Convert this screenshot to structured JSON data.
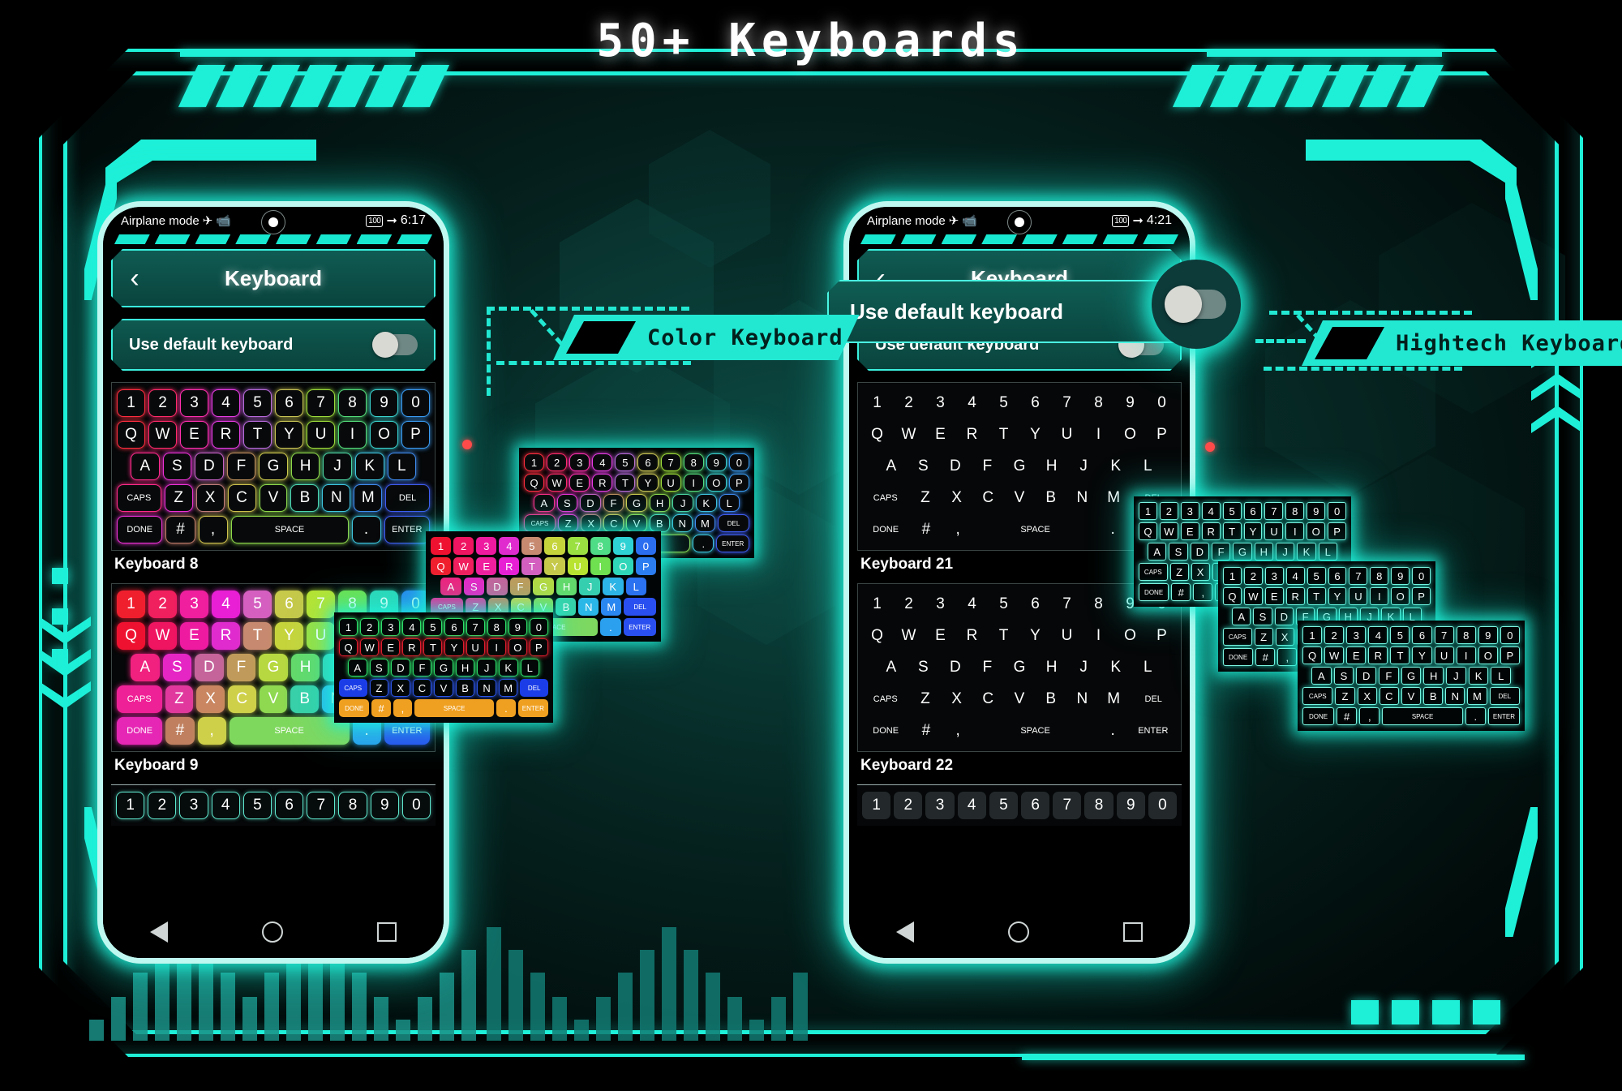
{
  "heading": "50+ Keyboards",
  "phones": {
    "left": {
      "status": {
        "airplane": "Airplane mode",
        "battery": "100",
        "time": "6:17"
      },
      "appbar": {
        "back": "‹",
        "title": "Keyboard"
      },
      "default_row": {
        "label": "Use default keyboard"
      },
      "keyboards": [
        {
          "name": "Keyboard 8"
        },
        {
          "name": "Keyboard 9"
        }
      ]
    },
    "right": {
      "status": {
        "airplane": "Airplane mode",
        "battery": "100",
        "time": "4:21"
      },
      "appbar": {
        "back": "‹",
        "title": "Keyboard"
      },
      "default_row": {
        "label": "Use default keyboard"
      },
      "keyboards": [
        {
          "name": "Keyboard 21"
        },
        {
          "name": "Keyboard 22"
        }
      ]
    }
  },
  "magnifier": {
    "label": "Use default keyboard"
  },
  "banners": {
    "color": "Color Keyboard",
    "hightech": "Hightech Keyboard"
  },
  "keys": {
    "row1": [
      "1",
      "2",
      "3",
      "4",
      "5",
      "6",
      "7",
      "8",
      "9",
      "0"
    ],
    "row2": [
      "Q",
      "W",
      "E",
      "R",
      "T",
      "Y",
      "U",
      "I",
      "O",
      "P"
    ],
    "row3": [
      "A",
      "S",
      "D",
      "F",
      "G",
      "H",
      "J",
      "K",
      "L"
    ],
    "row4": [
      "CAPS",
      "Z",
      "X",
      "C",
      "V",
      "B",
      "N",
      "M",
      "DEL"
    ],
    "row5": [
      "DONE",
      "#",
      ",",
      "SPACE",
      ".",
      "ENTER"
    ]
  },
  "colors": {
    "accent": "#1ef0d8",
    "panel": "#0e5950",
    "screen_bg": "#000000",
    "banner_bg": "#22e8d2",
    "node": "#ff4a4a",
    "rainbow": [
      "#ff1f3d",
      "#ff1f7a",
      "#ff22c8",
      "#d62ff5",
      "#b06ad0",
      "#c9c24a",
      "#9ad833",
      "#4fd86b",
      "#39d7c5",
      "#2f9bf2",
      "#2f5cf2"
    ]
  },
  "navbar": {
    "back": "back-triangle",
    "home": "home-circle",
    "recents": "recents-square"
  }
}
